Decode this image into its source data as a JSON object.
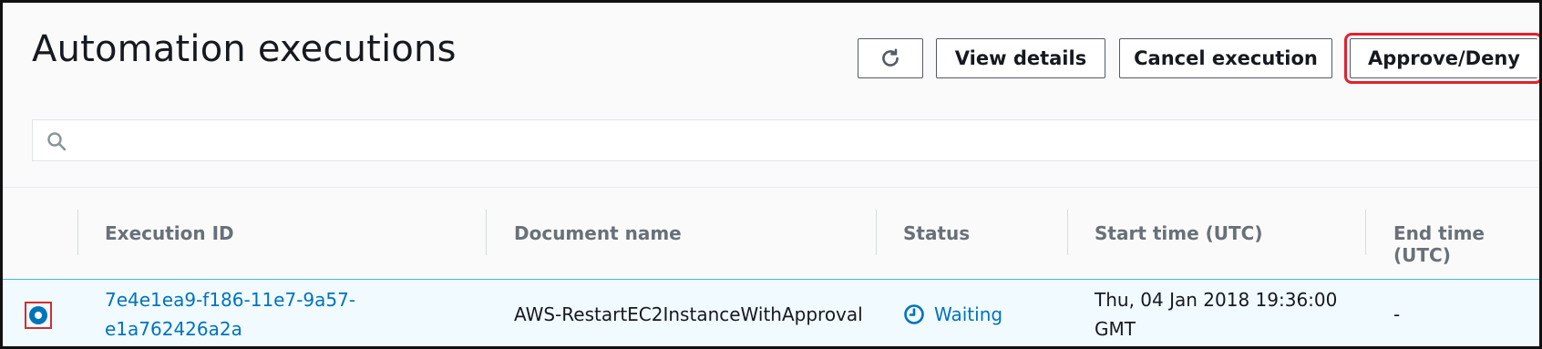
{
  "header": {
    "title": "Automation executions",
    "buttons": {
      "refresh_icon": "refresh-icon",
      "view_details": "View details",
      "cancel_execution": "Cancel execution",
      "approve_deny": "Approve/Deny"
    }
  },
  "search": {
    "icon": "search-icon",
    "placeholder": ""
  },
  "table": {
    "columns": [
      "Execution ID",
      "Document name",
      "Status",
      "Start time (UTC)",
      "End time (UTC)"
    ],
    "rows": [
      {
        "selected": true,
        "execution_id_line1": "7e4e1ea9-f186-11e7-9a57-",
        "execution_id_line2": "e1a762426a2a",
        "document_name": "AWS-RestartEC2InstanceWithApproval",
        "status": "Waiting",
        "status_icon": "clock-icon",
        "start_time_line1": "Thu, 04 Jan 2018 19:36:00",
        "start_time_line2": "GMT",
        "end_time": "-"
      }
    ]
  },
  "colors": {
    "link": "#0073bb",
    "highlight": "#e2212e",
    "selected_row_bg": "#f1faff"
  }
}
